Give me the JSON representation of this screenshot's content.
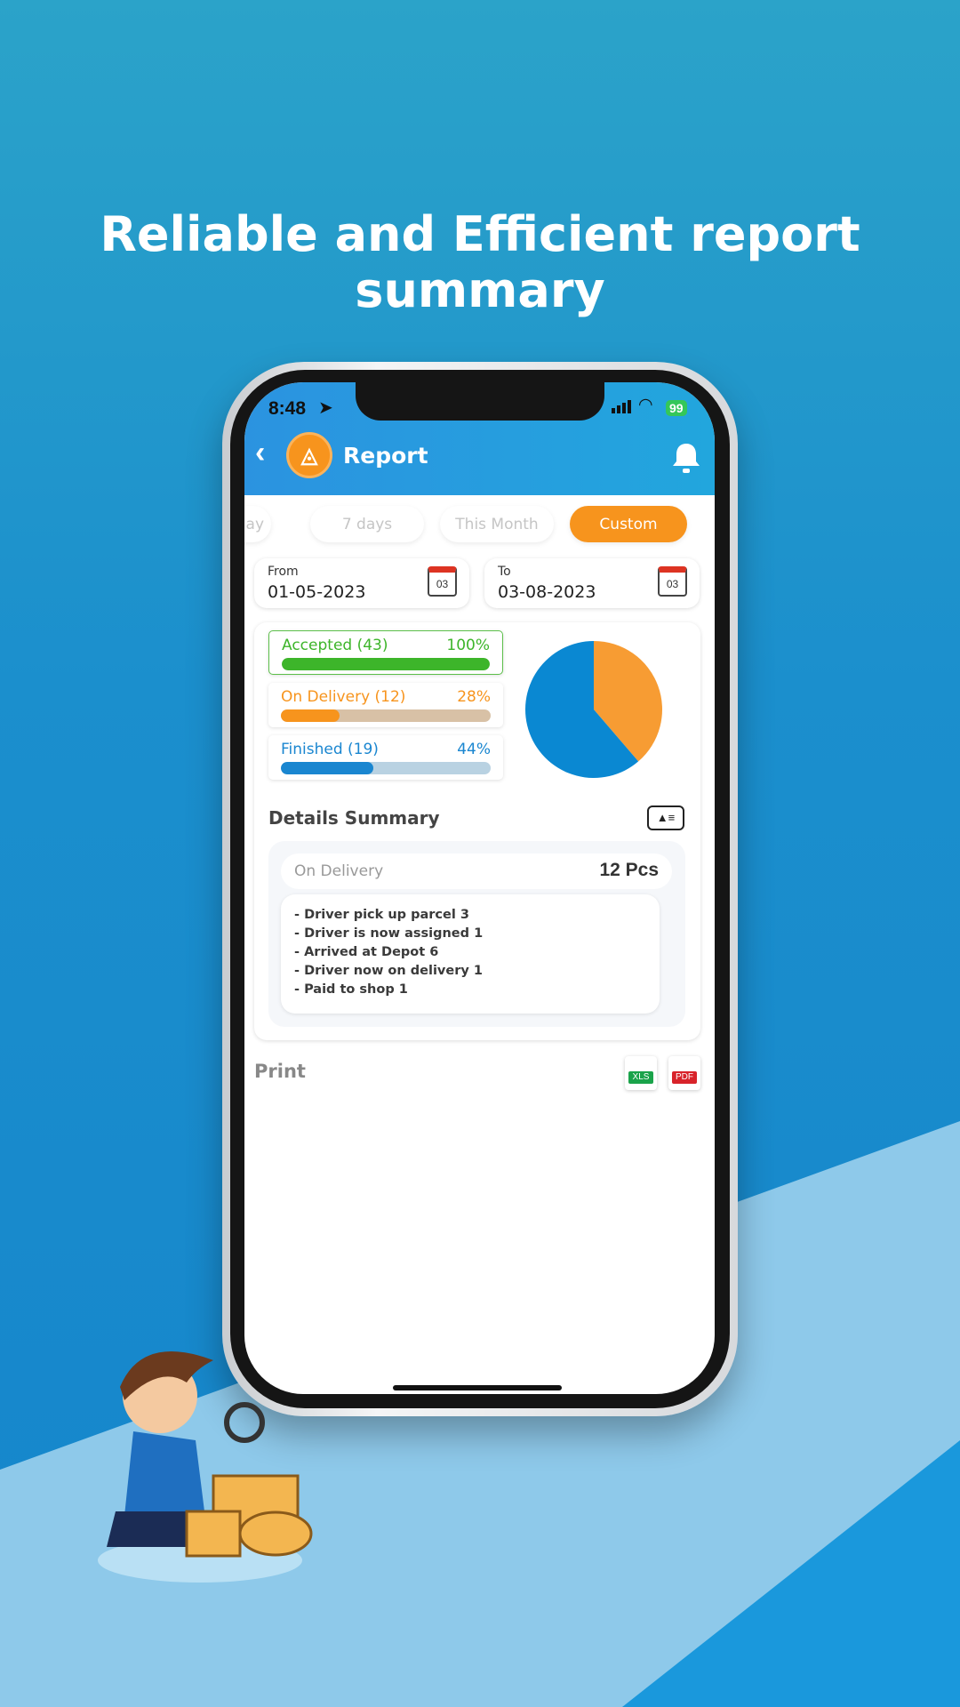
{
  "headline": "Reliable and Efficient report summary",
  "status_bar": {
    "time": "8:48",
    "battery": "99"
  },
  "app_bar": {
    "title": "Report",
    "back_icon": "chevron-left-icon",
    "logo": "app-logo",
    "bell_icon": "bell-icon"
  },
  "tabs": [
    {
      "label": "lay",
      "active": false
    },
    {
      "label": "7 days",
      "active": false
    },
    {
      "label": "This Month",
      "active": false
    },
    {
      "label": "Custom",
      "active": true
    }
  ],
  "date_range": {
    "from_label": "From",
    "from_value": "01-05-2023",
    "to_label": "To",
    "to_value": "03-08-2023",
    "calendar_day": "03"
  },
  "stats": [
    {
      "label": "Accepted (43)",
      "percent_text": "100%",
      "percent": 100,
      "color": "#3db52a"
    },
    {
      "label": "On Delivery (12)",
      "percent_text": "28%",
      "percent": 28,
      "color": "#f7941d"
    },
    {
      "label": "Finished (19)",
      "percent_text": "44%",
      "percent": 44,
      "color": "#1a86d0"
    }
  ],
  "chart_data": {
    "type": "pie",
    "values": [
      12,
      19
    ],
    "colors": [
      "#f79c33",
      "#0a88d2"
    ]
  },
  "details": {
    "title": "Details Summary",
    "status": "On Delivery",
    "count": "12 Pcs",
    "lines": [
      "- Driver pick up parcel 3",
      "- Driver is now assigned 1",
      "- Arrived at Depot 6",
      "- Driver now on delivery 1",
      "- Paid to shop 1"
    ]
  },
  "print": {
    "label": "Print",
    "xls": "XLS",
    "pdf": "PDF"
  },
  "colors": {
    "accent": "#f7941d",
    "header": "#2b93e0"
  }
}
